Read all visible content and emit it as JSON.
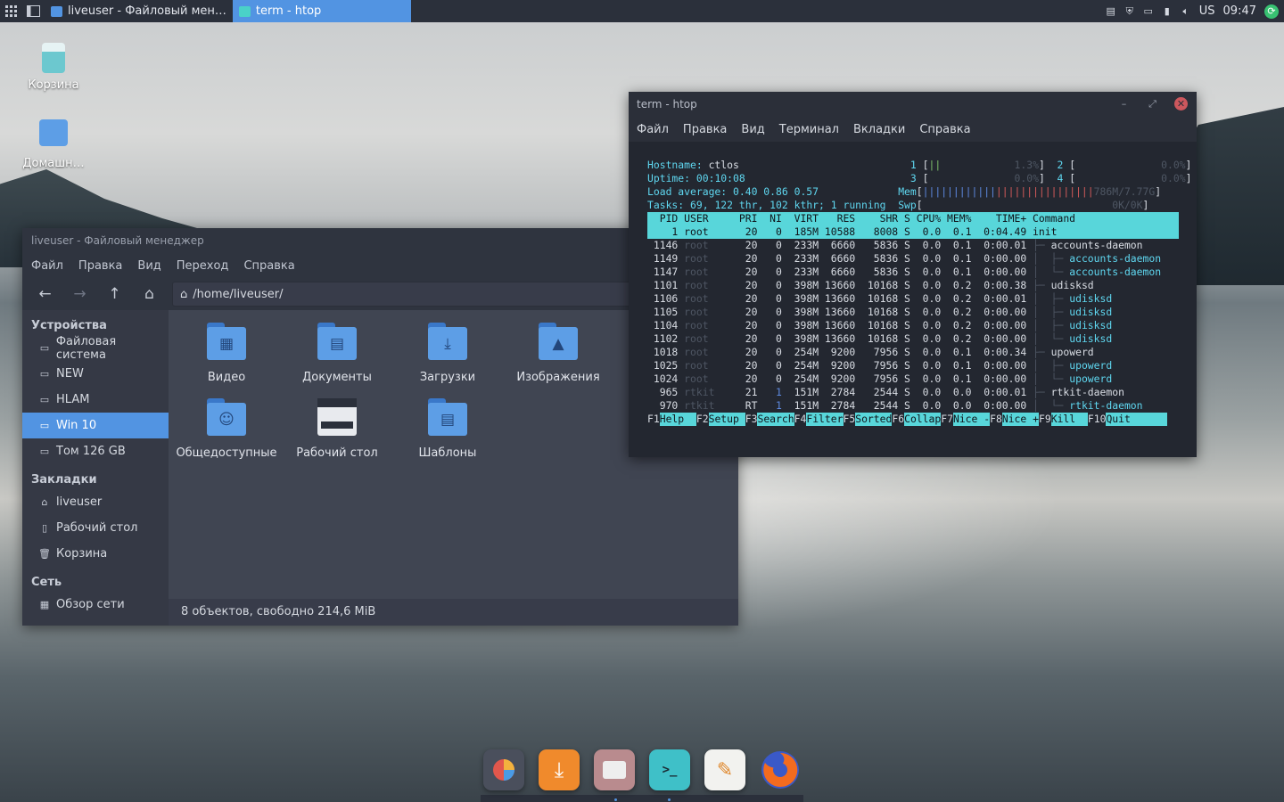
{
  "panel": {
    "tasks": [
      {
        "label": "liveuser - Файловый мен…",
        "active": false
      },
      {
        "label": "term - htop",
        "active": true
      }
    ],
    "tray": {
      "layout": "US",
      "time": "09:47"
    }
  },
  "desktop": {
    "icons": [
      {
        "label": "Корзина",
        "icon": "trash-icon"
      },
      {
        "label": "Домашн…",
        "icon": "home-folder-icon"
      }
    ]
  },
  "file_manager": {
    "title": "liveuser - Файловый менеджер",
    "menu": [
      "Файл",
      "Правка",
      "Вид",
      "Переход",
      "Справка"
    ],
    "path": "/home/liveuser/",
    "sidebar": {
      "devices_header": "Устройства",
      "devices": [
        "Файловая система",
        "NEW",
        "HLAM",
        "Win 10",
        "Том 126 GB"
      ],
      "selected_device": "Win 10",
      "bookmarks_header": "Закладки",
      "bookmarks": [
        "liveuser",
        "Рабочий стол",
        "Корзина"
      ],
      "network_header": "Сеть",
      "network": [
        "Обзор сети"
      ]
    },
    "items": [
      {
        "label": "Видео",
        "icon": "film-icon"
      },
      {
        "label": "Документы",
        "icon": "document-icon"
      },
      {
        "label": "Загрузки",
        "icon": "download-icon"
      },
      {
        "label": "Изображения",
        "icon": "image-icon"
      },
      {
        "label": "Общедоступные",
        "icon": "user-icon"
      },
      {
        "label": "Рабочий стол",
        "icon": "desktop-icon"
      },
      {
        "label": "Шаблоны",
        "icon": "template-icon"
      }
    ],
    "status": "8 объектов, свободно 214,6 MiB"
  },
  "terminal": {
    "title": "term - htop",
    "menu": [
      "Файл",
      "Правка",
      "Вид",
      "Терминал",
      "Вкладки",
      "Справка"
    ],
    "hostname": "ctlos",
    "uptime": "00:10:08",
    "load_average": "0.40 0.86 0.57",
    "tasks_line": "69, 122 thr, 102 kthr; 1 running",
    "cpus": [
      {
        "id": "1",
        "pct": "1.3%"
      },
      {
        "id": "2",
        "pct": "0.0%"
      },
      {
        "id": "3",
        "pct": "0.0%"
      },
      {
        "id": "4",
        "pct": "0.0%"
      }
    ],
    "mem": "786M/7.77G",
    "swp": "0K/0K",
    "columns": [
      "PID",
      "USER",
      "PRI",
      "NI",
      "VIRT",
      "RES",
      "SHR",
      "S",
      "CPU%",
      "MEM%",
      "TIME+",
      "Command"
    ],
    "processes": [
      [
        "1",
        "root",
        "20",
        "0",
        "185M",
        "10588",
        "8008",
        "S",
        "0.0",
        "0.1",
        "0:04.49",
        "init"
      ],
      [
        "1146",
        "root",
        "20",
        "0",
        "233M",
        "6660",
        "5836",
        "S",
        "0.0",
        "0.1",
        "0:00.01",
        "├─ accounts-daemon"
      ],
      [
        "1149",
        "root",
        "20",
        "0",
        "233M",
        "6660",
        "5836",
        "S",
        "0.0",
        "0.1",
        "0:00.00",
        "│  ├─ accounts-daemon"
      ],
      [
        "1147",
        "root",
        "20",
        "0",
        "233M",
        "6660",
        "5836",
        "S",
        "0.0",
        "0.1",
        "0:00.00",
        "│  └─ accounts-daemon"
      ],
      [
        "1101",
        "root",
        "20",
        "0",
        "398M",
        "13660",
        "10168",
        "S",
        "0.0",
        "0.2",
        "0:00.38",
        "├─ udisksd"
      ],
      [
        "1106",
        "root",
        "20",
        "0",
        "398M",
        "13660",
        "10168",
        "S",
        "0.0",
        "0.2",
        "0:00.01",
        "│  ├─ udisksd"
      ],
      [
        "1105",
        "root",
        "20",
        "0",
        "398M",
        "13660",
        "10168",
        "S",
        "0.0",
        "0.2",
        "0:00.00",
        "│  ├─ udisksd"
      ],
      [
        "1104",
        "root",
        "20",
        "0",
        "398M",
        "13660",
        "10168",
        "S",
        "0.0",
        "0.2",
        "0:00.00",
        "│  ├─ udisksd"
      ],
      [
        "1102",
        "root",
        "20",
        "0",
        "398M",
        "13660",
        "10168",
        "S",
        "0.0",
        "0.2",
        "0:00.00",
        "│  └─ udisksd"
      ],
      [
        "1018",
        "root",
        "20",
        "0",
        "254M",
        "9200",
        "7956",
        "S",
        "0.0",
        "0.1",
        "0:00.34",
        "├─ upowerd"
      ],
      [
        "1025",
        "root",
        "20",
        "0",
        "254M",
        "9200",
        "7956",
        "S",
        "0.0",
        "0.1",
        "0:00.00",
        "│  ├─ upowerd"
      ],
      [
        "1024",
        "root",
        "20",
        "0",
        "254M",
        "9200",
        "7956",
        "S",
        "0.0",
        "0.1",
        "0:00.00",
        "│  └─ upowerd"
      ],
      [
        "965",
        "rtkit",
        "21",
        "1",
        "151M",
        "2784",
        "2544",
        "S",
        "0.0",
        "0.0",
        "0:00.01",
        "├─ rtkit-daemon"
      ],
      [
        "970",
        "rtkit",
        "RT",
        "1",
        "151M",
        "2784",
        "2544",
        "S",
        "0.0",
        "0.0",
        "0:00.00",
        "│  └─ rtkit-daemon"
      ]
    ],
    "fkeys": [
      {
        "key": "F1",
        "label": "Help  "
      },
      {
        "key": "F2",
        "label": "Setup "
      },
      {
        "key": "F3",
        "label": "Search"
      },
      {
        "key": "F4",
        "label": "Filter"
      },
      {
        "key": "F5",
        "label": "Sorted"
      },
      {
        "key": "F6",
        "label": "Collap"
      },
      {
        "key": "F7",
        "label": "Nice -"
      },
      {
        "key": "F8",
        "label": "Nice +"
      },
      {
        "key": "F9",
        "label": "Kill  "
      },
      {
        "key": "F10",
        "label": "Quit      "
      }
    ]
  },
  "dock": {
    "apps": [
      "pie-chart-app-icon",
      "download-manager-icon",
      "files-app-icon",
      "terminal-app-icon",
      "text-editor-icon",
      "firefox-icon"
    ]
  },
  "colors": {
    "accent": "#5294e2",
    "panel": "#2b303b",
    "htop_header": "#58d6da",
    "close": "#cc575d"
  }
}
